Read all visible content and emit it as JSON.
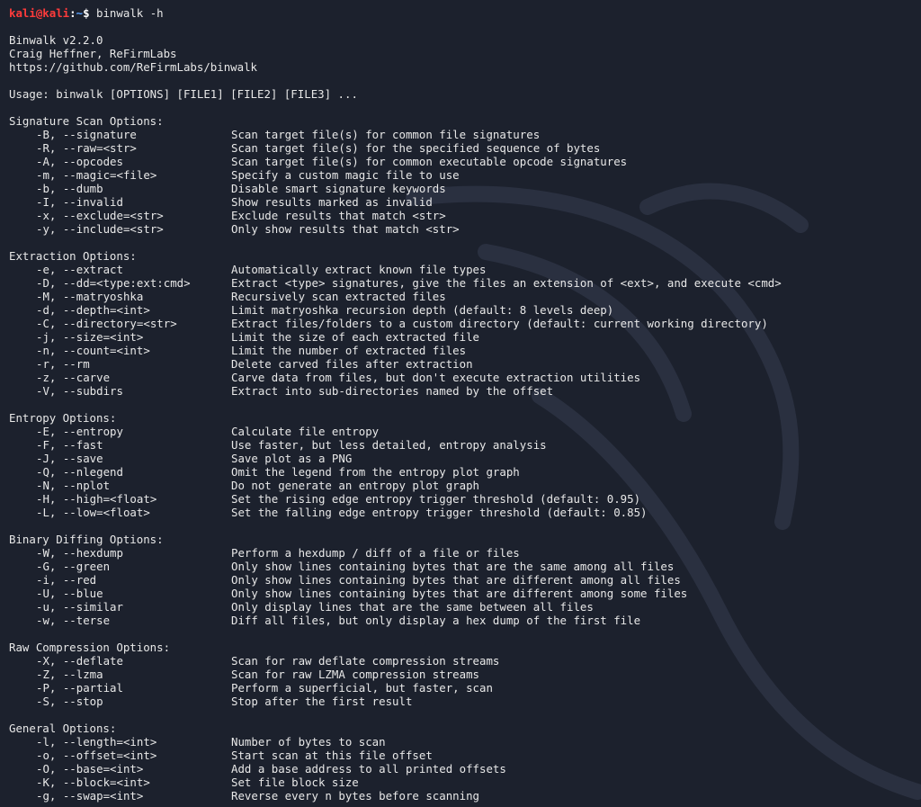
{
  "prompt": {
    "user_host": "kali@kali",
    "path": "~",
    "symbol": "$",
    "command": "binwalk -h"
  },
  "header": {
    "version": "Binwalk v2.2.0",
    "author": "Craig Heffner, ReFirmLabs",
    "url": "https://github.com/ReFirmLabs/binwalk"
  },
  "usage": "Usage: binwalk [OPTIONS] [FILE1] [FILE2] [FILE3] ...",
  "sections": [
    {
      "title": "Signature Scan Options:",
      "options": [
        {
          "flag": "-B, --signature",
          "desc": "Scan target file(s) for common file signatures"
        },
        {
          "flag": "-R, --raw=<str>",
          "desc": "Scan target file(s) for the specified sequence of bytes"
        },
        {
          "flag": "-A, --opcodes",
          "desc": "Scan target file(s) for common executable opcode signatures"
        },
        {
          "flag": "-m, --magic=<file>",
          "desc": "Specify a custom magic file to use"
        },
        {
          "flag": "-b, --dumb",
          "desc": "Disable smart signature keywords"
        },
        {
          "flag": "-I, --invalid",
          "desc": "Show results marked as invalid"
        },
        {
          "flag": "-x, --exclude=<str>",
          "desc": "Exclude results that match <str>"
        },
        {
          "flag": "-y, --include=<str>",
          "desc": "Only show results that match <str>"
        }
      ]
    },
    {
      "title": "Extraction Options:",
      "options": [
        {
          "flag": "-e, --extract",
          "desc": "Automatically extract known file types"
        },
        {
          "flag": "-D, --dd=<type:ext:cmd>",
          "desc": "Extract <type> signatures, give the files an extension of <ext>, and execute <cmd>"
        },
        {
          "flag": "-M, --matryoshka",
          "desc": "Recursively scan extracted files"
        },
        {
          "flag": "-d, --depth=<int>",
          "desc": "Limit matryoshka recursion depth (default: 8 levels deep)"
        },
        {
          "flag": "-C, --directory=<str>",
          "desc": "Extract files/folders to a custom directory (default: current working directory)"
        },
        {
          "flag": "-j, --size=<int>",
          "desc": "Limit the size of each extracted file"
        },
        {
          "flag": "-n, --count=<int>",
          "desc": "Limit the number of extracted files"
        },
        {
          "flag": "-r, --rm",
          "desc": "Delete carved files after extraction"
        },
        {
          "flag": "-z, --carve",
          "desc": "Carve data from files, but don't execute extraction utilities"
        },
        {
          "flag": "-V, --subdirs",
          "desc": "Extract into sub-directories named by the offset"
        }
      ]
    },
    {
      "title": "Entropy Options:",
      "options": [
        {
          "flag": "-E, --entropy",
          "desc": "Calculate file entropy"
        },
        {
          "flag": "-F, --fast",
          "desc": "Use faster, but less detailed, entropy analysis"
        },
        {
          "flag": "-J, --save",
          "desc": "Save plot as a PNG"
        },
        {
          "flag": "-Q, --nlegend",
          "desc": "Omit the legend from the entropy plot graph"
        },
        {
          "flag": "-N, --nplot",
          "desc": "Do not generate an entropy plot graph"
        },
        {
          "flag": "-H, --high=<float>",
          "desc": "Set the rising edge entropy trigger threshold (default: 0.95)"
        },
        {
          "flag": "-L, --low=<float>",
          "desc": "Set the falling edge entropy trigger threshold (default: 0.85)"
        }
      ]
    },
    {
      "title": "Binary Diffing Options:",
      "options": [
        {
          "flag": "-W, --hexdump",
          "desc": "Perform a hexdump / diff of a file or files"
        },
        {
          "flag": "-G, --green",
          "desc": "Only show lines containing bytes that are the same among all files"
        },
        {
          "flag": "-i, --red",
          "desc": "Only show lines containing bytes that are different among all files"
        },
        {
          "flag": "-U, --blue",
          "desc": "Only show lines containing bytes that are different among some files"
        },
        {
          "flag": "-u, --similar",
          "desc": "Only display lines that are the same between all files"
        },
        {
          "flag": "-w, --terse",
          "desc": "Diff all files, but only display a hex dump of the first file"
        }
      ]
    },
    {
      "title": "Raw Compression Options:",
      "options": [
        {
          "flag": "-X, --deflate",
          "desc": "Scan for raw deflate compression streams"
        },
        {
          "flag": "-Z, --lzma",
          "desc": "Scan for raw LZMA compression streams"
        },
        {
          "flag": "-P, --partial",
          "desc": "Perform a superficial, but faster, scan"
        },
        {
          "flag": "-S, --stop",
          "desc": "Stop after the first result"
        }
      ]
    },
    {
      "title": "General Options:",
      "options": [
        {
          "flag": "-l, --length=<int>",
          "desc": "Number of bytes to scan"
        },
        {
          "flag": "-o, --offset=<int>",
          "desc": "Start scan at this file offset"
        },
        {
          "flag": "-O, --base=<int>",
          "desc": "Add a base address to all printed offsets"
        },
        {
          "flag": "-K, --block=<int>",
          "desc": "Set file block size"
        },
        {
          "flag": "-g, --swap=<int>",
          "desc": "Reverse every n bytes before scanning"
        }
      ]
    }
  ],
  "colors": {
    "background": "#1c212d",
    "text": "#e8e8e8",
    "prompt_user": "#ff3b3b",
    "prompt_path": "#5aa2ff"
  }
}
